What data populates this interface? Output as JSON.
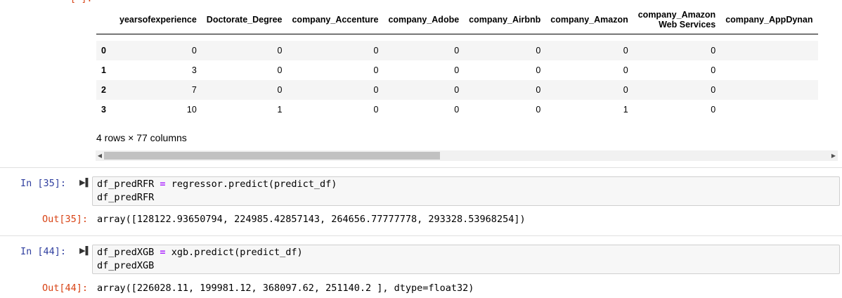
{
  "top_prompt": "[ ]:",
  "dataframe": {
    "columns": [
      "yearsofexperience",
      "Doctorate_Degree",
      "company_Accenture",
      "company_Adobe",
      "company_Airbnb",
      "company_Amazon",
      "company_Amazon Web Services",
      "company_AppDynamics"
    ],
    "columns_display": [
      [
        "yearsofexperience"
      ],
      [
        "Doctorate_Degree"
      ],
      [
        "company_Accenture"
      ],
      [
        "company_Adobe"
      ],
      [
        "company_Airbnb"
      ],
      [
        "company_Amazon"
      ],
      [
        "company_Amazon",
        "Web Services"
      ],
      [
        "company_AppDynan"
      ]
    ],
    "rows": [
      {
        "index": "0",
        "values": [
          "0",
          "0",
          "0",
          "0",
          "0",
          "0",
          "0"
        ]
      },
      {
        "index": "1",
        "values": [
          "3",
          "0",
          "0",
          "0",
          "0",
          "0",
          "0"
        ]
      },
      {
        "index": "2",
        "values": [
          "7",
          "0",
          "0",
          "0",
          "0",
          "0",
          "0"
        ]
      },
      {
        "index": "3",
        "values": [
          "10",
          "1",
          "0",
          "0",
          "0",
          "1",
          "0"
        ]
      }
    ],
    "shape": "4 rows × 77 columns",
    "scroll_fraction": 0.45
  },
  "cells": [
    {
      "in_prompt": "In [35]:",
      "code_line1_var": "df_predRFR",
      "code_line1_op": "=",
      "code_line1_rest": "regressor.predict(predict_df)",
      "code_line2": "df_predRFR",
      "out_prompt": "Out[35]:",
      "output": "array([128122.93650794, 224985.42857143, 264656.77777778, 293328.53968254])"
    },
    {
      "in_prompt": "In [44]:",
      "code_line1_var": "df_predXGB",
      "code_line1_op": "=",
      "code_line1_rest": "xgb.predict(predict_df)",
      "code_line2": "df_predXGB",
      "out_prompt": "Out[44]:",
      "output": "array([226028.11, 199981.12, 368097.62, 251140.2 ], dtype=float32)"
    }
  ],
  "icons": {
    "run": "run-cell-icon",
    "scroll_left": "scroll-left-arrow-icon",
    "scroll_right": "scroll-right-arrow-icon"
  }
}
